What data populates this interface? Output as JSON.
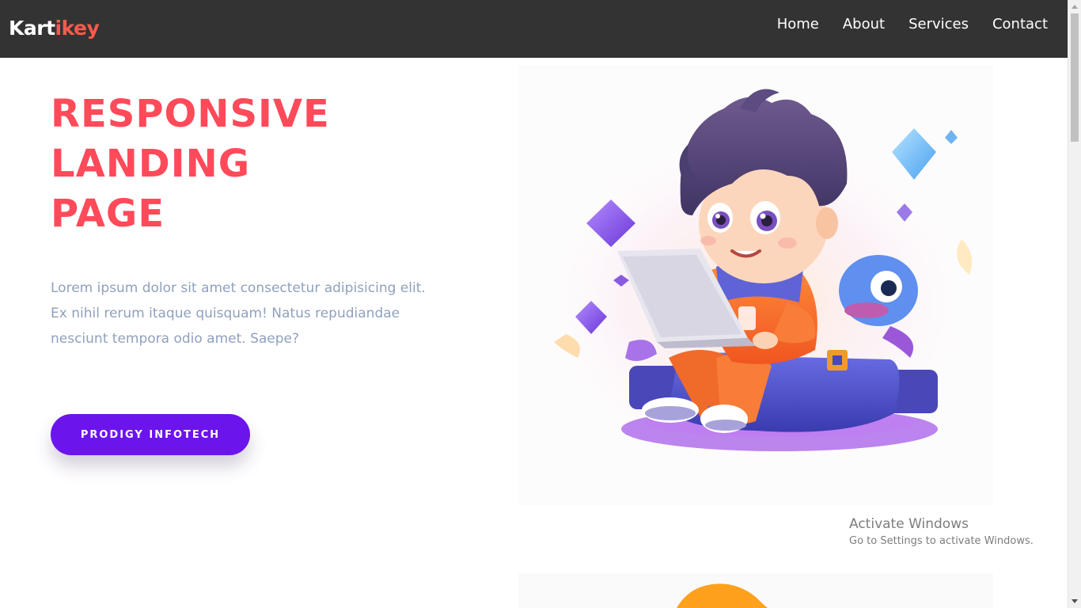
{
  "navbar": {
    "brand_part1": "Kart",
    "brand_part2": "ikey",
    "links": [
      "Home",
      "About",
      "Services",
      "Contact"
    ]
  },
  "hero": {
    "title_lines": [
      "RESPONSIVE",
      "LANDING",
      "PAGE"
    ],
    "description": "Lorem ipsum dolor sit amet consectetur adipisicing elit. Ex nihil rerum itaque quisquam! Natus repudiandae nesciunt tempora odio amet. Saepe?",
    "button_label": "PRODIGY INFOTECH"
  },
  "watermark": {
    "title": "Activate Windows",
    "subtitle": "Go to Settings to activate Windows."
  },
  "colors": {
    "navbar_bg": "#333333",
    "brand_accent": "#ff5a4e",
    "title": "#ff4a5a",
    "description": "#8fa1bd",
    "button_bg": "#6c14ec"
  },
  "icons": [
    "hero-illustration-boy-with-laptop",
    "scroll-up-arrow-icon",
    "scroll-down-arrow-icon"
  ]
}
